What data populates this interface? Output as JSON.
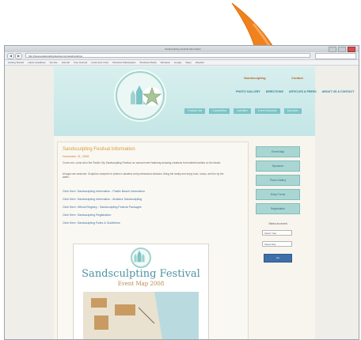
{
  "browser": {
    "title": "Sandsculpting Festival Information",
    "url": "http://www.sandsculptingfestival.com/sandsculpting",
    "bookmarks": [
      "Getting Started",
      "Latest Headlines",
      "Sunrise",
      "Hotmail",
      "Free Hotmail",
      "Customize Links",
      "Windows Marketplace",
      "Windows Media",
      "Windows",
      "Google",
      "Maps",
      "Weather"
    ]
  },
  "site": {
    "top_links": [
      "Sandsculpting",
      "Contact"
    ],
    "menu": [
      "PHOTO GALLERY",
      "DIRECTIONS",
      "ARTICLES & PRESS",
      "ABOUT US & CONTACT"
    ],
    "submenu": [
      "Festival Info",
      "Competition",
      "Activities",
      "Event Schedule",
      "Sponsors"
    ]
  },
  "article": {
    "heading": "Sandsculpting Festival Information",
    "date": "November 21, 2008",
    "para1": "Come one, come all to the Pacific City Sandsculpting Festival, an annual event featuring amazing creations from talented artists on the beach.",
    "para2": "All ages are welcome. Sculptors compete for prizes in amateur and professional divisions. Bring the family and enjoy food, music, and fun by the water.",
    "links": [
      "Click Here: Sandsculpting Information - Pacific Beach Information",
      "Click Here: Sandsculpting Information - Amateur Sandsculpting",
      "Click Here: Official Registry - Sandsculpting Festival Packages",
      "Click Here: Sandsculpting Registration",
      "Click Here: Sandsculpting Rules & Guidelines"
    ],
    "poster_title": "Sandsculpting Festival",
    "poster_subtitle": "Event Map 2008"
  },
  "sidebar": {
    "buttons": [
      "Event Map",
      "Sponsors",
      "Photo Gallery",
      "Entry Forms",
      "Registration"
    ],
    "label": "Select an event",
    "select1": "Select Year",
    "select2": "Select Day",
    "go": "Go"
  },
  "colors": {
    "accent_orange": "#f0821e",
    "teal": "#7cc4c6",
    "link_blue": "#3d6ea0"
  }
}
